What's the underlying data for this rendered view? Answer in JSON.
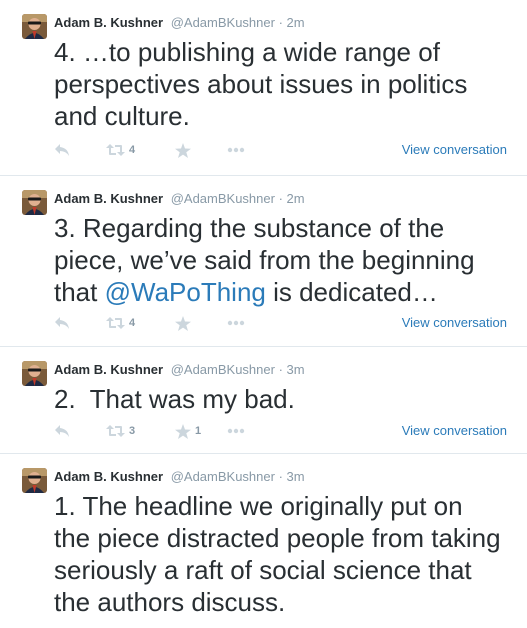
{
  "tweets": [
    {
      "fullname": "Adam B. Kushner",
      "username": "@AdamBKushner",
      "separator": "·",
      "time": "2m",
      "text": "4. …to publishing a wide range of perspectives about issues in politics and culture.",
      "retweets": "4",
      "favorites": "",
      "view_link": "View conversation"
    },
    {
      "fullname": "Adam B. Kushner",
      "username": "@AdamBKushner",
      "separator": "·",
      "time": "2m",
      "text_before": "3. Regarding the substance of the piece, we’ve said from the beginning that ",
      "mention": "@WaPoThing",
      "text_after": " is dedicated…",
      "retweets": "4",
      "favorites": "",
      "view_link": "View conversation"
    },
    {
      "fullname": "Adam B. Kushner",
      "username": "@AdamBKushner",
      "separator": "·",
      "time": "3m",
      "text": "2.  That was my bad.",
      "retweets": "3",
      "favorites": "1",
      "view_link": "View conversation"
    },
    {
      "fullname": "Adam B. Kushner",
      "username": "@AdamBKushner",
      "separator": "·",
      "time": "3m",
      "text": "1. The headline we originally put on the piece distracted people from taking seriously a raft of social science that the authors discuss."
    }
  ],
  "icons": {
    "reply": "reply-icon",
    "retweet": "retweet-icon",
    "favorite": "star-icon",
    "more": "more-icon"
  },
  "colors": {
    "link": "#2b7bb9",
    "meta": "#8899a6",
    "icon": "#ccd6dd",
    "text": "#292f33"
  }
}
